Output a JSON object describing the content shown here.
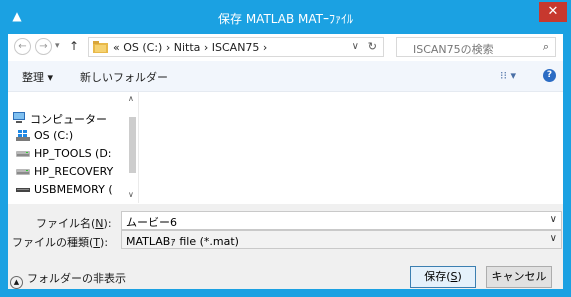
{
  "window": {
    "title": "保存 MATLAB MATｰﾌｧｲﾙ",
    "close_glyph": "✕",
    "app_glyph": "▲"
  },
  "address_bar": {
    "back_glyph": "←",
    "forward_glyph": "→",
    "dropdown_glyph": "▾",
    "up_glyph": "↑",
    "path": "« OS (C:) › Nitta › ISCAN75 ›",
    "dropdown": "∨",
    "refresh": "↻",
    "search_placeholder": "ISCAN75の検索",
    "search_icon": "⌕"
  },
  "toolbar": {
    "organize": "整理 ▾",
    "new_folder": "新しいフォルダー",
    "view": "⁝⁝ ▾",
    "help": "?"
  },
  "nav_pane": {
    "up_arrow": "∧",
    "down_arrow": "∨",
    "items": [
      {
        "label": "コンピューター",
        "icon": "computer-icon"
      },
      {
        "label": "OS (C:)",
        "icon": "windows-drive-icon"
      },
      {
        "label": "HP_TOOLS (D:",
        "icon": "drive-icon"
      },
      {
        "label": "HP_RECOVERY",
        "icon": "drive-icon"
      },
      {
        "label": "USBMEMORY (",
        "icon": "usb-drive-icon"
      }
    ]
  },
  "form": {
    "filename_label": "ファイル名(",
    "filename_key": "N",
    "filename_label_end": "):",
    "filename_value": "ムービー6",
    "filetype_label": "ファイルの種類(",
    "filetype_key": "T",
    "filetype_label_end": "):",
    "filetype_value": "MATLABｧ file (*.mat)",
    "dd_glyph": "∨"
  },
  "footer": {
    "hide_folders": "フォルダーの非表示",
    "save_prefix": "保存(",
    "save_key": "S",
    "save_suffix": ")",
    "cancel": "キャンセル"
  },
  "colors": {
    "titlebar": "#1ba1e2",
    "close": "#c7382e",
    "toolbar": "#f2f6fc",
    "footer": "#f0f0f0"
  }
}
